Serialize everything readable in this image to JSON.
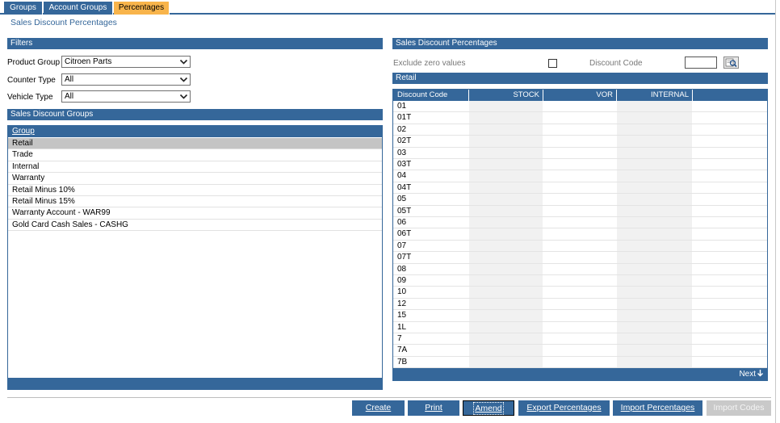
{
  "tabs": [
    {
      "label": "Groups",
      "active": false
    },
    {
      "label": "Account Groups",
      "active": false
    },
    {
      "label": "Percentages",
      "active": true
    }
  ],
  "page_title": "Sales Discount Percentages",
  "filters": {
    "header": "Filters",
    "product_group": {
      "label": "Product Group",
      "value": "Citroen Parts"
    },
    "counter_type": {
      "label": "Counter Type",
      "value": "All"
    },
    "vehicle_type": {
      "label": "Vehicle Type",
      "value": "All"
    }
  },
  "groups": {
    "header": "Sales Discount Groups",
    "column": "Group",
    "rows": [
      "Retail",
      "Trade",
      "Internal",
      "Warranty",
      "Retail Minus 10%",
      "Retail Minus 15%",
      "Warranty Account - WAR99",
      "Gold Card Cash Sales - CASHG"
    ],
    "selected_index": 0
  },
  "percentages": {
    "header": "Sales Discount Percentages",
    "exclude_zero_label": "Exclude zero values",
    "exclude_zero_checked": false,
    "discount_code_label": "Discount Code",
    "discount_code_value": "",
    "grid_title": "Retail",
    "columns": [
      "Discount Code",
      "STOCK",
      "VOR",
      "INTERNAL"
    ],
    "rows": [
      "01",
      "01T",
      "02",
      "02T",
      "03",
      "03T",
      "04",
      "04T",
      "05",
      "05T",
      "06",
      "06T",
      "07",
      "07T",
      "08",
      "09",
      "10",
      "12",
      "15",
      "1L",
      "7",
      "7A",
      "7B"
    ],
    "next_label": "Next"
  },
  "buttons": {
    "create": "Create",
    "print": "Print",
    "amend": "Amend",
    "export": "Export Percentages",
    "import": "Import Percentages",
    "import_codes": "Import Codes"
  },
  "colors": {
    "primary": "#35679a",
    "active_tab": "#f8b44b",
    "selected_row": "#c4c4c4",
    "disabled": "#c9c9c9"
  }
}
